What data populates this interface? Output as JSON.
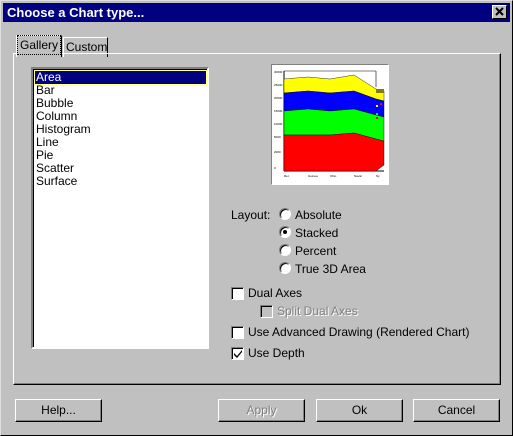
{
  "window": {
    "title": "Choose a Chart type...",
    "close_glyph": "✕"
  },
  "tabs": [
    {
      "label": "Gallery",
      "active": true
    },
    {
      "label": "Custom",
      "active": false
    }
  ],
  "chart_types": {
    "selected": "Area",
    "items": [
      "Area",
      "Bar",
      "Bubble",
      "Column",
      "Histogram",
      "Line",
      "Pie",
      "Scatter",
      "Surface"
    ]
  },
  "preview": {
    "icon": "stacked-area-chart-thumbnail",
    "series_colors": [
      "#ff0000",
      "#00ff00",
      "#0000ff",
      "#ffff00"
    ]
  },
  "layout": {
    "label": "Layout:",
    "selected": "Stacked",
    "options": [
      "Absolute",
      "Stacked",
      "Percent",
      "True 3D Area"
    ]
  },
  "options": {
    "dual_axes": {
      "label": "Dual Axes",
      "checked": false
    },
    "split_dual_axes": {
      "label": "Split Dual Axes",
      "checked": false,
      "enabled": false
    },
    "advanced_drawing": {
      "label": "Use Advanced Drawing (Rendered Chart)",
      "checked": false
    },
    "use_depth": {
      "label": "Use Depth",
      "checked": true
    }
  },
  "buttons": {
    "help": "Help...",
    "apply": "Apply",
    "ok": "Ok",
    "cancel": "Cancel"
  }
}
